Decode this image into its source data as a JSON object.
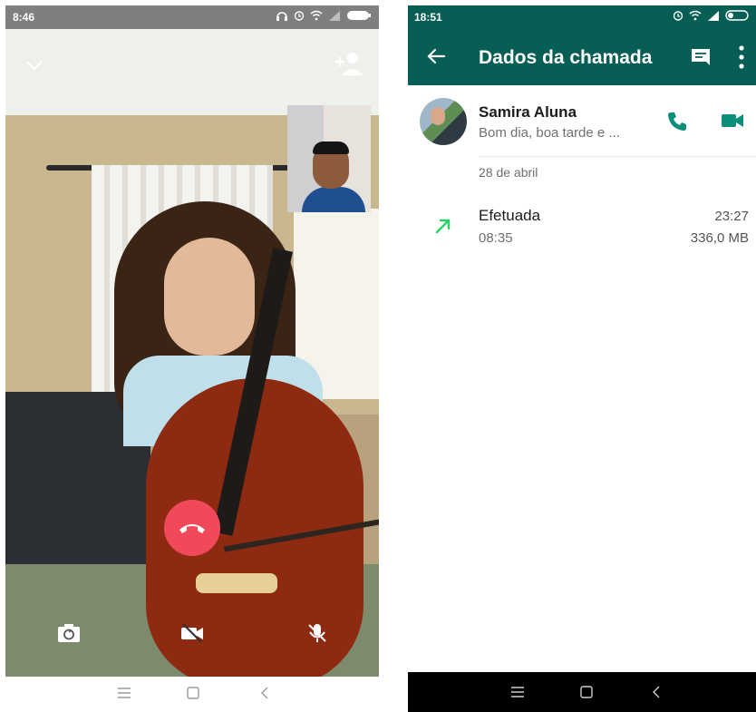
{
  "left_screen": {
    "status_time": "8:46",
    "nav": {
      "menu_icon": "menu-icon",
      "home_icon": "home-icon",
      "back_icon": "back-icon"
    }
  },
  "right_screen": {
    "status_time": "18:51",
    "title": "Dados da chamada",
    "contact": {
      "name": "Samira Aluna",
      "status": "Bom dia, boa tarde e ..."
    },
    "date": "28 de abril",
    "call": {
      "type": "Efetuada",
      "duration": "08:35",
      "time": "23:27",
      "size": "336,0 MB"
    }
  },
  "colors": {
    "whatsapp_green": "#075e54",
    "accent_green": "#25d366",
    "end_call_red": "#f04a5a"
  }
}
